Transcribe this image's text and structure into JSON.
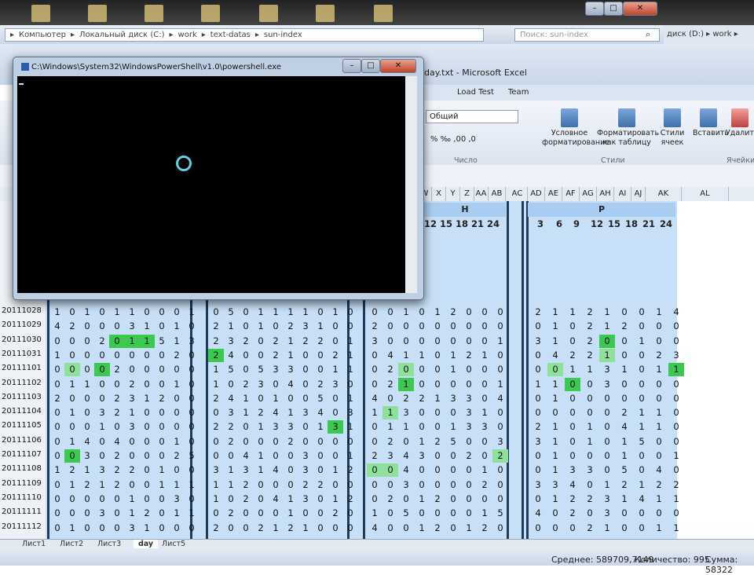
{
  "explorer": {
    "path": [
      "Компьютер",
      "Локальный диск (C:)",
      "work",
      "text-datas",
      "sun-index"
    ],
    "search_placeholder": "Поиск: sun-index",
    "right_crumbs": "диск (D:) ▸ work ▸"
  },
  "excel": {
    "title": "day.txt - Microsoft Excel",
    "ribbon_tabs": [
      "Load Test",
      "Team"
    ],
    "number_format": "Общий",
    "buttons": {
      "cond_format": "Условное форматирование",
      "format_table": "Форматировать как таблицу",
      "cell_styles": "Стили ячеек",
      "insert": "Вставить",
      "delete": "Удалить"
    },
    "groups": {
      "number": "Число",
      "styles": "Стили",
      "cells": "Ячейки"
    },
    "columns": [
      "W",
      "X",
      "Y",
      "Z",
      "AA",
      "AB",
      "AC",
      "AD",
      "AE",
      "AF",
      "AG",
      "AH",
      "AI",
      "AJ",
      "AK",
      "AL"
    ],
    "band_labels": [
      "H",
      "P"
    ],
    "hours": [
      "12",
      "15",
      "18",
      "21",
      "24",
      "3",
      "6",
      "9",
      "12",
      "15",
      "18",
      "21",
      "24"
    ],
    "row_labels": [
      "20111028",
      "20111029",
      "20111030",
      "20111031",
      "20111101",
      "20111102",
      "20111103",
      "20111104",
      "20111105",
      "20111106",
      "20111107",
      "20111108",
      "20111109",
      "20111110",
      "20111111",
      "20111112"
    ],
    "sheet_tabs": [
      "Лист1",
      "Лист2",
      "Лист3",
      "day",
      "Лист5"
    ],
    "status": {
      "avg_label": "Среднее: 589709,7149",
      "count_label": "Количество: 995",
      "sum_label": "Сумма: 58322"
    }
  },
  "powershell": {
    "title": "C:\\Windows\\System32\\WindowsPowerShell\\v1.0\\powershell.exe"
  },
  "colors": {
    "grid_bg": "#c7dff7",
    "highlight": "#3cc94f",
    "highlight_light": "#8fe09a",
    "console": "#000000"
  }
}
